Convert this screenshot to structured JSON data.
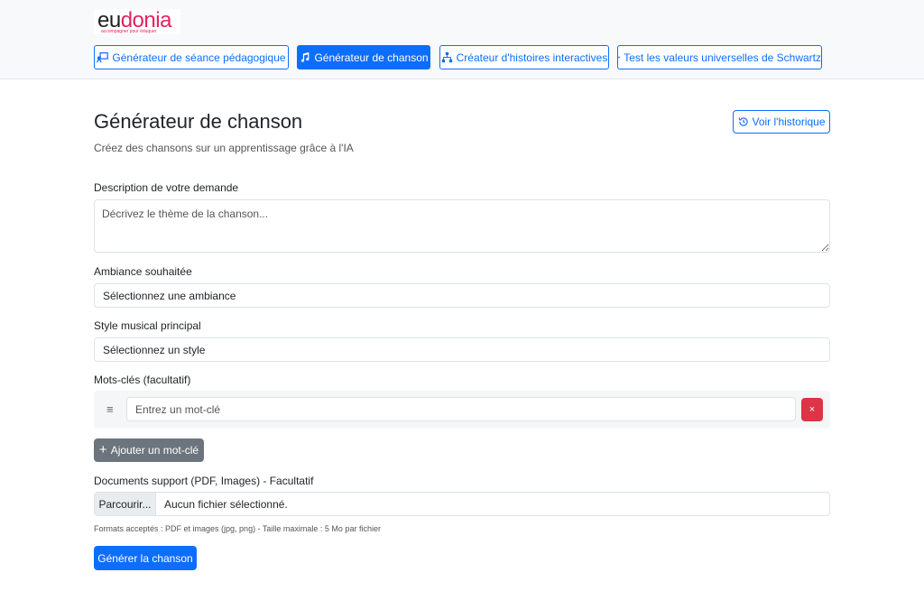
{
  "brand": {
    "logo_part1": "eu",
    "logo_part2": "donia",
    "tagline": "accompagner pour éduquer",
    "accent_color": "#e0245e"
  },
  "nav": {
    "items": [
      {
        "label": "Générateur de séance pédagogique",
        "icon": "teacher-board-icon",
        "active": false
      },
      {
        "label": "Générateur de chanson",
        "icon": "music-note-icon",
        "active": true
      },
      {
        "label": "Créateur d'histoires interactives",
        "icon": "diagram-icon",
        "active": false
      },
      {
        "label": "Test les valeurs universelles de Schwartz",
        "icon": "box-icon",
        "active": false
      }
    ]
  },
  "header": {
    "title": "Générateur de chanson",
    "subtitle": "Créez des chansons sur un apprentissage grâce à l'IA",
    "history_button": "Voir l'historique",
    "history_icon": "history-icon"
  },
  "form": {
    "description": {
      "label": "Description de votre demande",
      "placeholder": "Décrivez le thème de la chanson..."
    },
    "mood": {
      "label": "Ambiance souhaitée",
      "selected": "Sélectionnez une ambiance"
    },
    "style": {
      "label": "Style musical principal",
      "selected": "Sélectionnez un style"
    },
    "keywords": {
      "label": "Mots-clés (facultatif)",
      "drag_icon": "drag-handle-icon",
      "placeholder": "Entrez un mot-clé",
      "remove_symbol": "×",
      "add_label": "Ajouter un mot-clé",
      "add_symbol": "+"
    },
    "documents": {
      "label": "Documents support (PDF, Images) - Facultatif",
      "browse_label": "Parcourir...",
      "file_status": "Aucun fichier sélectionné.",
      "help": "Formats acceptés : PDF et images (jpg, png) - Taille maximale : 5 Mo par fichier"
    },
    "submit_label": "Générer la chanson"
  },
  "colors": {
    "primary": "#0d6efd",
    "secondary": "#6c757d",
    "danger": "#dc3545"
  }
}
